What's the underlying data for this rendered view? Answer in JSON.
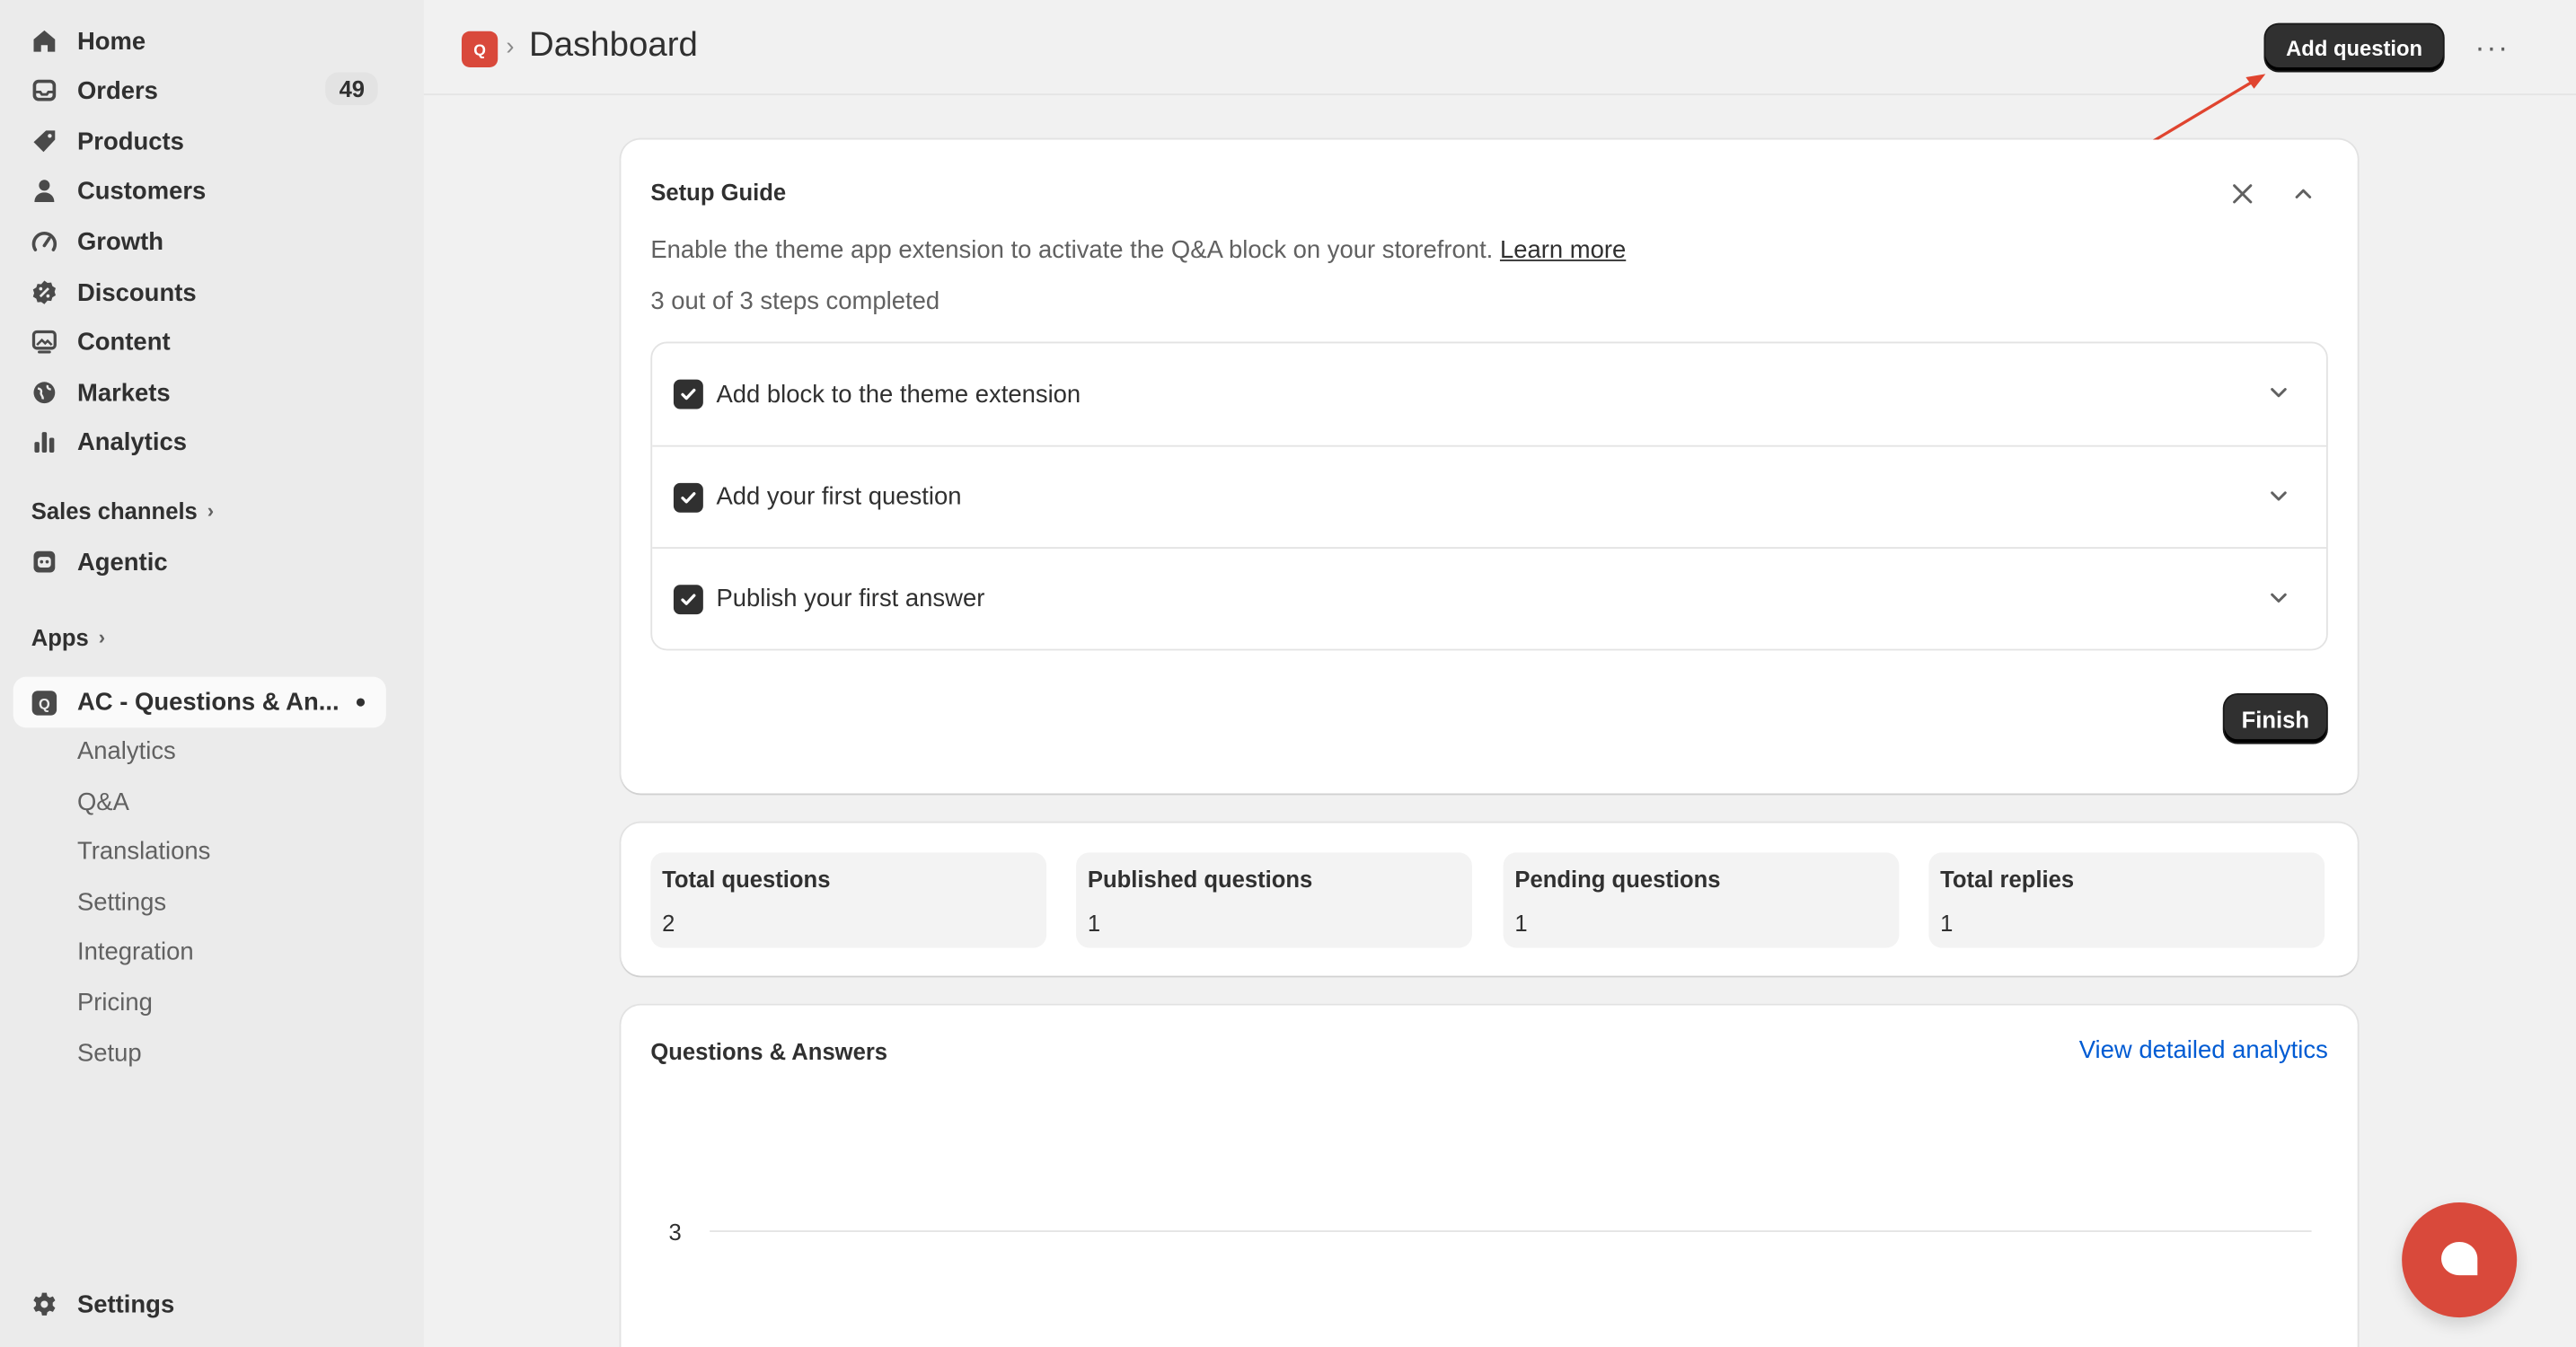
{
  "sidebar": {
    "nav": [
      {
        "label": "Home",
        "icon": "home-icon"
      },
      {
        "label": "Orders",
        "icon": "inbox-icon",
        "badge": "49"
      },
      {
        "label": "Products",
        "icon": "tag-icon"
      },
      {
        "label": "Customers",
        "icon": "person-icon"
      },
      {
        "label": "Growth",
        "icon": "gauge-icon"
      },
      {
        "label": "Discounts",
        "icon": "discount-icon"
      },
      {
        "label": "Content",
        "icon": "image-icon"
      },
      {
        "label": "Markets",
        "icon": "globe-icon"
      },
      {
        "label": "Analytics",
        "icon": "bar-chart-icon"
      }
    ],
    "sales_channels_label": "Sales channels",
    "agentic_label": "Agentic",
    "apps_label": "Apps",
    "app_name": "AC - Questions & An...",
    "app_sub_items": [
      "Analytics",
      "Q&A",
      "Translations",
      "Settings",
      "Integration",
      "Pricing",
      "Setup"
    ],
    "settings_label": "Settings"
  },
  "header": {
    "title": "Dashboard",
    "add_question_label": "Add question",
    "more_label": "···"
  },
  "setup_guide": {
    "title": "Setup Guide",
    "description": "Enable the theme app extension to activate the Q&A block on your storefront.",
    "learn_more": "Learn more",
    "progress": "3 out of 3 steps completed",
    "steps": [
      {
        "label": "Add block to the theme extension",
        "checked": true
      },
      {
        "label": "Add your first question",
        "checked": true
      },
      {
        "label": "Publish your first answer",
        "checked": true
      }
    ],
    "finish_label": "Finish"
  },
  "stats": [
    {
      "label": "Total questions",
      "value": "2"
    },
    {
      "label": "Published questions",
      "value": "1"
    },
    {
      "label": "Pending questions",
      "value": "1"
    },
    {
      "label": "Total replies",
      "value": "1"
    }
  ],
  "qa_card": {
    "title": "Questions & Answers",
    "analytics_link": "View detailed analytics",
    "y_tick_top": "3"
  },
  "colors": {
    "accent": "#d9493b",
    "link": "#005bd3",
    "primary_button": "#303030"
  }
}
